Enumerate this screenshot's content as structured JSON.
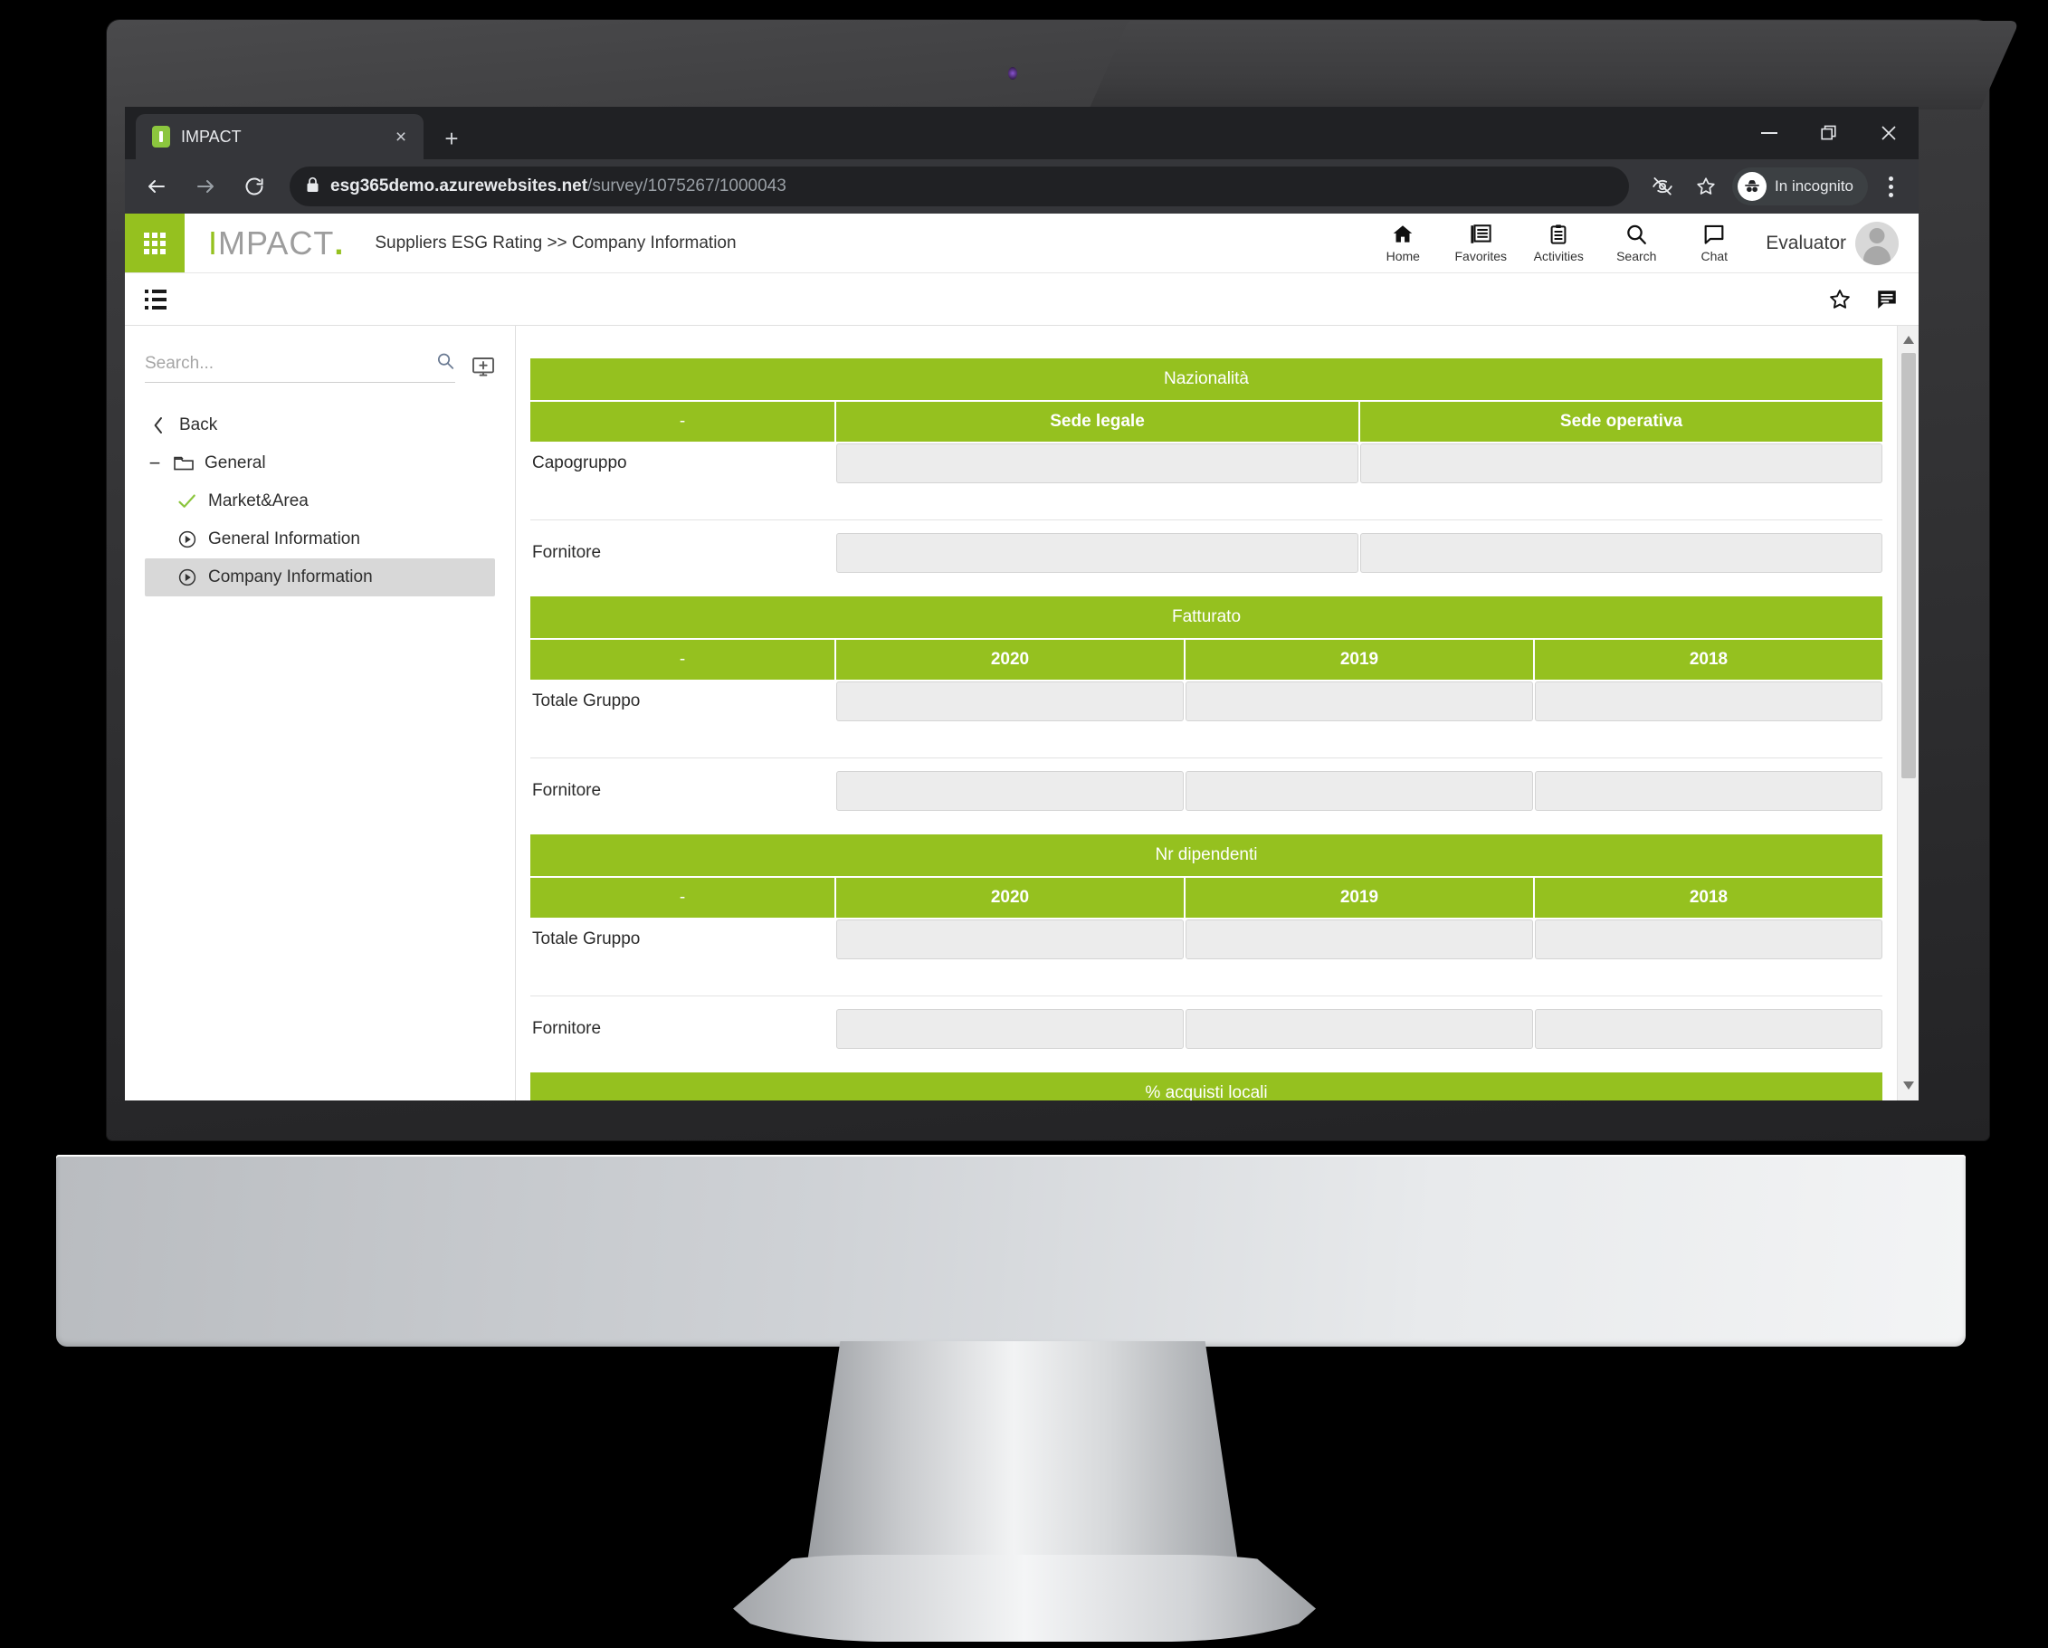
{
  "browser": {
    "tab": {
      "title": "IMPACT",
      "favicon": "impact-favicon",
      "close_label": "×"
    },
    "new_tab_label": "+",
    "window_controls": {
      "minimize": "–",
      "restore": "restore",
      "close": "×"
    },
    "url": {
      "secure_host": "esg365demo.azurewebsites.net",
      "path": "/survey/1075267/1000043",
      "lock_icon": "lock-icon"
    },
    "incognito_label": "In incognito",
    "toolbar_icons": [
      "eye-slash-icon",
      "star-icon",
      "incognito-icon",
      "kebab-menu-icon"
    ],
    "nav_buttons": [
      "back-icon",
      "forward-icon",
      "reload-icon"
    ]
  },
  "app": {
    "brand": {
      "prefix": "I",
      "rest": "MPACT",
      "dot": "."
    },
    "breadcrumb": "Suppliers ESG Rating >> Company Information",
    "nav": [
      {
        "label": "Home",
        "icon": "home-icon"
      },
      {
        "label": "Favorites",
        "icon": "favorites-icon"
      },
      {
        "label": "Activities",
        "icon": "activities-icon"
      },
      {
        "label": "Search",
        "icon": "search-icon"
      },
      {
        "label": "Chat",
        "icon": "chat-icon"
      }
    ],
    "user": "Evaluator",
    "subbar": {
      "list_icon": "list-view-icon",
      "star_icon": "star-outline-icon",
      "comment_icon": "comment-icon"
    },
    "accent_green": "#95c11f",
    "selected_row_bg": "#d8d8d8"
  },
  "sidebar": {
    "search_placeholder": "Search...",
    "search_value": "",
    "search_icon": "search-icon",
    "add_icon": "add-screen-icon",
    "back_label": "Back",
    "tree": [
      {
        "label": "General",
        "icon": "folder-icon",
        "toggle": "−",
        "level": 1,
        "selected": false
      },
      {
        "label": "Market&Area",
        "icon": "check-icon",
        "level": 2,
        "selected": false
      },
      {
        "label": "General Information",
        "icon": "play-circle-icon",
        "level": 2,
        "selected": false
      },
      {
        "label": "Company Information",
        "icon": "play-circle-icon",
        "level": 2,
        "selected": true
      }
    ]
  },
  "tables": [
    {
      "title": "Nazionalità",
      "columns": [
        "-",
        "Sede legale",
        "Sede operativa"
      ],
      "rows": [
        {
          "label": "Capogruppo",
          "values": [
            "",
            ""
          ]
        },
        {
          "label": "Fornitore",
          "values": [
            "",
            ""
          ]
        }
      ]
    },
    {
      "title": "Fatturato",
      "columns": [
        "-",
        "2020",
        "2019",
        "2018"
      ],
      "rows": [
        {
          "label": "Totale Gruppo",
          "values": [
            "",
            "",
            ""
          ]
        },
        {
          "label": "Fornitore",
          "values": [
            "",
            "",
            ""
          ]
        }
      ]
    },
    {
      "title": "Nr dipendenti",
      "columns": [
        "-",
        "2020",
        "2019",
        "2018"
      ],
      "rows": [
        {
          "label": "Totale Gruppo",
          "values": [
            "",
            "",
            ""
          ]
        },
        {
          "label": "Fornitore",
          "values": [
            "",
            "",
            ""
          ]
        }
      ]
    },
    {
      "title": "% acquisti locali",
      "columns": [],
      "rows": []
    }
  ]
}
